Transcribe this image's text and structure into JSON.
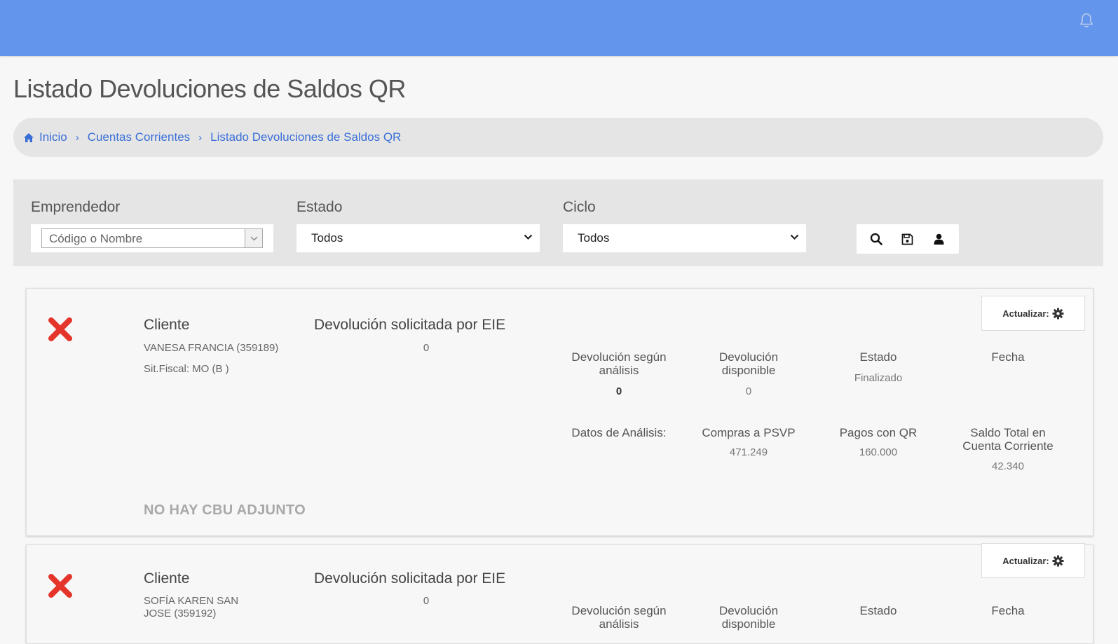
{
  "header": {
    "bell_icon": "bell-icon",
    "color": "#6495ed"
  },
  "page": {
    "title": "Listado Devoluciones de Saldos QR"
  },
  "breadcrumb": {
    "home_icon": "home-icon",
    "items": [
      "Inicio",
      "Cuentas Corrientes",
      "Listado Devoluciones de Saldos QR"
    ]
  },
  "filters": {
    "emprendedor": {
      "label": "Emprendedor",
      "placeholder": "Código o Nombre"
    },
    "estado": {
      "label": "Estado",
      "value": "Todos"
    },
    "ciclo": {
      "label": "Ciclo",
      "value": "Todos"
    },
    "tools": [
      "search-icon",
      "save-icon",
      "user-icon"
    ]
  },
  "cards": [
    {
      "status_icon": "x-icon",
      "cliente_label": "Cliente",
      "cliente_name": "VANESA FRANCIA (359189)",
      "sit_fiscal": "Sit.Fiscal: MO (B )",
      "solicitada_label": "Devolución solicitada por EIE",
      "solicitada_value": "0",
      "update_label": "Actualizar:",
      "update_icon": "gear-icon",
      "row1": [
        {
          "label": "Devolución según análisis",
          "value": "0"
        },
        {
          "label": "Devolución disponible",
          "value": "0"
        },
        {
          "label": "Estado",
          "value": "Finalizado"
        },
        {
          "label": "Fecha",
          "value": ""
        }
      ],
      "row2": [
        {
          "label": "Datos de Análisis:",
          "value": ""
        },
        {
          "label": "Compras a PSVP",
          "value": "471.249"
        },
        {
          "label": "Pagos con QR",
          "value": "160.000"
        },
        {
          "label": "Saldo Total en Cuenta Corriente",
          "value": "42.340"
        }
      ],
      "cbu_notice": "NO HAY CBU ADJUNTO"
    },
    {
      "status_icon": "x-icon",
      "cliente_label": "Cliente",
      "cliente_name": "SOFÍA KAREN SAN JOSE (359192)",
      "solicitada_label": "Devolución solicitada por EIE",
      "solicitada_value": "0",
      "update_label": "Actualizar:",
      "update_icon": "gear-icon",
      "row1": [
        {
          "label": "Devolución según análisis"
        },
        {
          "label": "Devolución disponible"
        },
        {
          "label": "Estado"
        },
        {
          "label": "Fecha"
        }
      ]
    }
  ]
}
